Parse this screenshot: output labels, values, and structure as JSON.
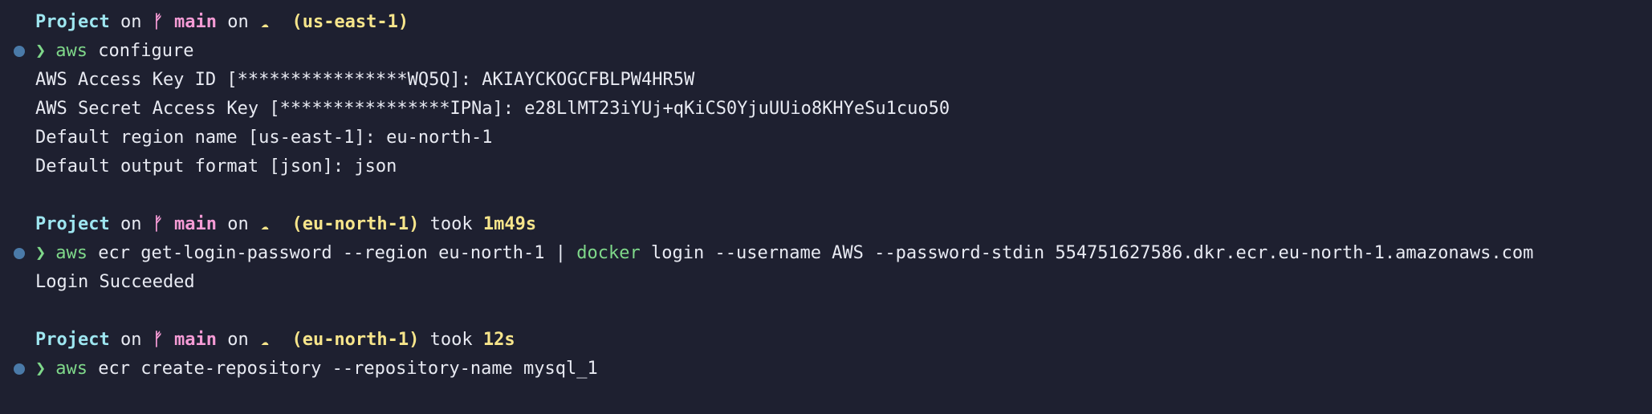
{
  "colors": {
    "background": "#1e2030",
    "text": "#e8eaf2",
    "project": "#9ee6f0",
    "branch": "#f59bd5",
    "region": "#f7e58b",
    "duration": "#f7e58b",
    "command": "#7fd88a",
    "prompt_arrow": "#7fd88a",
    "status_dot": "#4a7aa8"
  },
  "prompt_symbols": {
    "branch_icon": "git-branch-icon",
    "cloud_icon": "cloud-icon",
    "arrow": "❯"
  },
  "blocks": [
    {
      "prompt": {
        "project": "Project",
        "on1": "on",
        "branch_glyph": "ᚠ",
        "branch": "main",
        "on2": "on",
        "cloud_glyph": "☁",
        "region": "(us-east-1)",
        "took": "",
        "duration": ""
      },
      "command": {
        "tool": "aws",
        "args": " configure",
        "tool2": "",
        "args2": ""
      },
      "output": [
        "AWS Access Key ID [****************WQ5Q]: AKIAYCKOGCFBLPW4HR5W",
        "AWS Secret Access Key [****************IPNa]: 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",
        "Default region name [us-east-1]: eu-north-1",
        "Default output format [json]: json"
      ]
    },
    {
      "prompt": {
        "project": "Project",
        "on1": "on",
        "branch_glyph": "ᚠ",
        "branch": "main",
        "on2": "on",
        "cloud_glyph": "☁",
        "region": "(eu-north-1)",
        "took": "took",
        "duration": "1m49s"
      },
      "command": {
        "tool": "aws",
        "args": " ecr get-login-password --region eu-north-1 | ",
        "tool2": "docker",
        "args2": " login --username AWS --password-stdin 554751627586.dkr.ecr.eu-north-1.amazonaws.com"
      },
      "output": [
        "Login Succeeded"
      ]
    },
    {
      "prompt": {
        "project": "Project",
        "on1": "on",
        "branch_glyph": "ᚠ",
        "branch": "main",
        "on2": "on",
        "cloud_glyph": "☁",
        "region": "(eu-north-1)",
        "took": "took",
        "duration": "12s"
      },
      "command": {
        "tool": "aws",
        "args": " ecr create-repository --repository-name mysql_1",
        "tool2": "",
        "args2": ""
      },
      "output": []
    }
  ]
}
